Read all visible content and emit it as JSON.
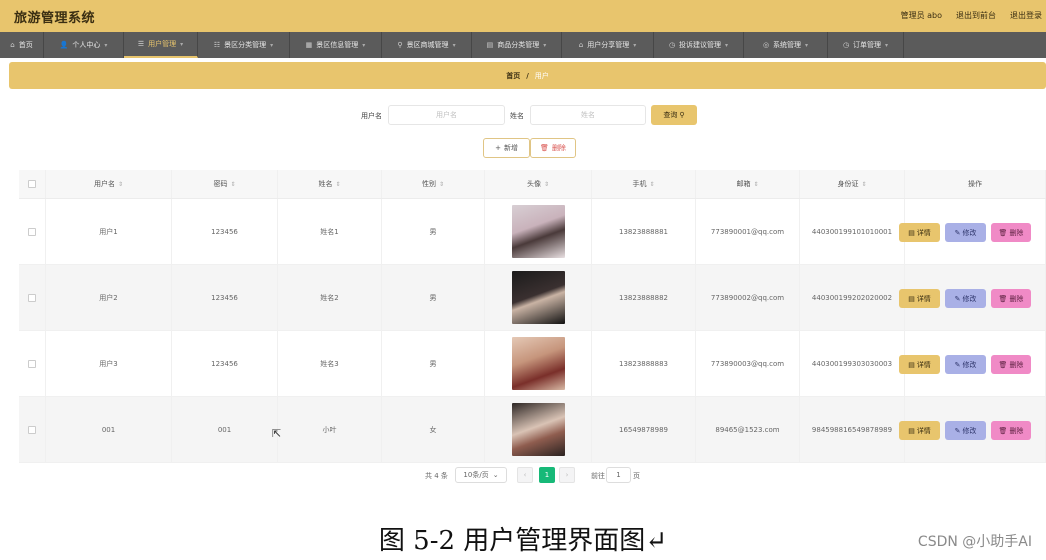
{
  "app_title": "旅游管理系统",
  "top_links": {
    "admin": "管理员 abo",
    "frontend": "退出到前台",
    "logout": "退出登录"
  },
  "nav": [
    {
      "label": "首页",
      "icon": "home-icon",
      "glyph": "⌂",
      "caret": ""
    },
    {
      "label": "个人中心",
      "icon": "user-icon",
      "glyph": "👤",
      "caret": "▾"
    },
    {
      "label": "用户管理",
      "icon": "list-icon",
      "glyph": "☰",
      "caret": "▾"
    },
    {
      "label": "景区分类管理",
      "icon": "sliders-icon",
      "glyph": "☷",
      "caret": "▾"
    },
    {
      "label": "景区信息管理",
      "icon": "chart-icon",
      "glyph": "▦",
      "caret": "▾"
    },
    {
      "label": "景区商城管理",
      "icon": "mic-icon",
      "glyph": "⚲",
      "caret": "▾"
    },
    {
      "label": "商品分类管理",
      "icon": "grid-icon",
      "glyph": "▤",
      "caret": "▾"
    },
    {
      "label": "用户分享管理",
      "icon": "bank-icon",
      "glyph": "⌂",
      "caret": "▾"
    },
    {
      "label": "投诉建议管理",
      "icon": "clock-icon",
      "glyph": "◷",
      "caret": "▾"
    },
    {
      "label": "系统管理",
      "icon": "compass-icon",
      "glyph": "◎",
      "caret": "▾"
    },
    {
      "label": "订单管理",
      "icon": "time-icon",
      "glyph": "◷",
      "caret": "▾"
    }
  ],
  "breadcrumb": {
    "home": "首页",
    "sep": "/",
    "current": "用户"
  },
  "search": {
    "username_label": "用户名",
    "username_placeholder": "用户名",
    "name_label": "姓名",
    "name_placeholder": "姓名",
    "button": "查询"
  },
  "actions": {
    "add": "新增",
    "delete": "删除"
  },
  "table": {
    "headers": [
      "用户名",
      "密码",
      "姓名",
      "性别",
      "头像",
      "手机",
      "邮箱",
      "身份证",
      "操作"
    ],
    "rows": [
      {
        "username": "用户1",
        "password": "123456",
        "name": "姓名1",
        "gender": "男",
        "avatar": "av1",
        "phone": "13823888881",
        "email": "773890001@qq.com",
        "id_card": "440300199101010001"
      },
      {
        "username": "用户2",
        "password": "123456",
        "name": "姓名2",
        "gender": "男",
        "avatar": "av2",
        "phone": "13823888882",
        "email": "773890002@qq.com",
        "id_card": "440300199202020002"
      },
      {
        "username": "用户3",
        "password": "123456",
        "name": "姓名3",
        "gender": "男",
        "avatar": "av3",
        "phone": "13823888883",
        "email": "773890003@qq.com",
        "id_card": "440300199303030003"
      },
      {
        "username": "001",
        "password": "001",
        "name": "小叶",
        "gender": "女",
        "avatar": "av4",
        "phone": "16549878989",
        "email": "89465@1523.com",
        "id_card": "984598816549878989"
      }
    ],
    "row_actions": {
      "detail": "详情",
      "edit": "修改",
      "remove": "删除"
    }
  },
  "pagination": {
    "total": "共 4 条",
    "page_size": "10条/页",
    "current_page": "1",
    "goto_label": "前往",
    "goto_value": "1",
    "page_suffix": "页"
  },
  "caption": "图 5-2 用户管理界面图↵",
  "watermark": "CSDN @小助手AI"
}
